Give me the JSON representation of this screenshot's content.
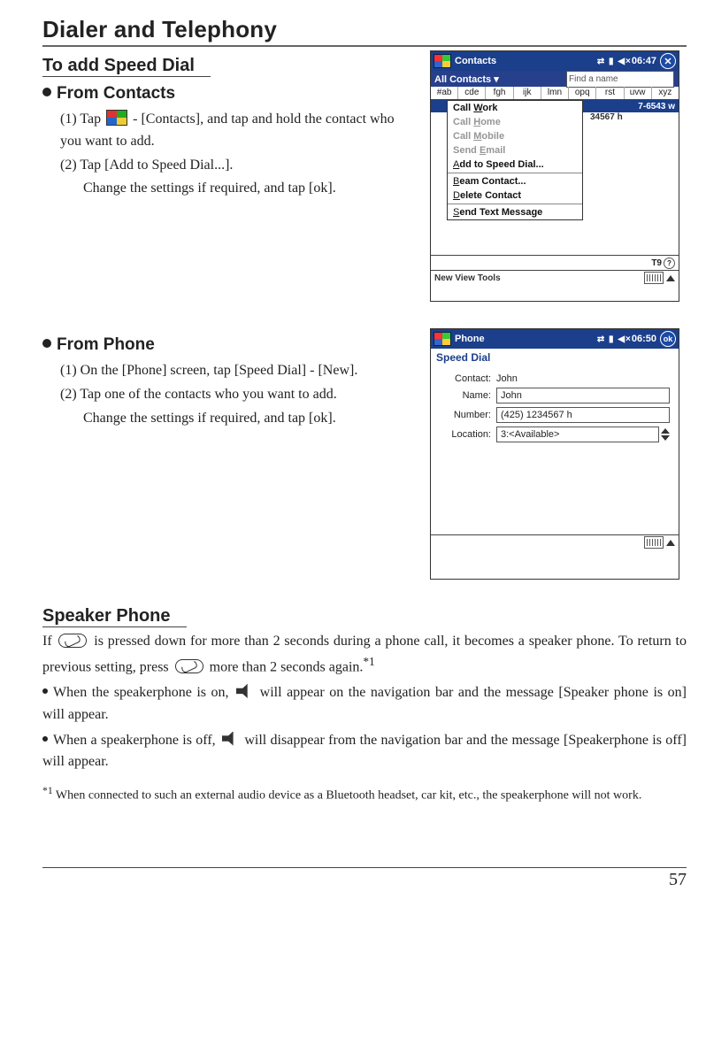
{
  "chapter_title": "Dialer and Telephony",
  "section1": {
    "title": "To add Speed Dial",
    "from_contacts": {
      "heading": "From Contacts",
      "step1": "(1) Tap ",
      "step1b": " - [Contacts], and tap and hold the contact who you want to add.",
      "step2": "(2) Tap [Add to Speed Dial...].",
      "step2b": "Change the settings if required, and tap [ok]."
    },
    "from_phone": {
      "heading": "From Phone",
      "step1": "(1) On the [Phone] screen,  tap [Speed Dial] - [New].",
      "step2": "(2) Tap one of the contacts who you want to add.",
      "step2b": "Change the settings if required, and tap [ok]."
    }
  },
  "shot_contacts": {
    "title": "Contacts",
    "time": "06:47",
    "find_label": "Find a name",
    "all": "All Contacts ▾",
    "alpha": [
      "#ab",
      "cde",
      "fgh",
      "ijk",
      "lmn",
      "opq",
      "rst",
      "uvw",
      "xyz"
    ],
    "bg_num1": "7-6543       w",
    "bg_num2": "34567         h",
    "menu": {
      "call_work": "Call Work",
      "call_home": "Call Home",
      "call_mobile": "Call Mobile",
      "send_email": "Send Email",
      "add_speed": "Add to Speed Dial...",
      "beam": "Beam Contact...",
      "delete": "Delete Contact",
      "send_text": "Send Text Message"
    },
    "footer_right": "T9",
    "footer": "New  View  Tools"
  },
  "shot_phone": {
    "title": "Phone",
    "time": "06:50",
    "ok": "ok",
    "subtitle": "Speed Dial",
    "contact_lbl": "Contact:",
    "contact_val": "John",
    "name_lbl": "Name:",
    "name_val": "John",
    "number_lbl": "Number:",
    "number_val": "(425) 1234567 h",
    "location_lbl": "Location:",
    "location_val": "3:<Available>"
  },
  "section2": {
    "title": "Speaker Phone",
    "p1a": "If ",
    "p1b": " is pressed down for more than 2 seconds during a phone call, it becomes a speaker phone.  To return to previous setting, press ",
    "p1c": " more than 2 seconds again.",
    "sup": "*1",
    "b1a": "When the speakerphone is on,  ",
    "b1b": " will appear on the navigation bar and the message [Speaker phone is on] will appear.",
    "b2a": "When a speakerphone is off, ",
    "b2b": " will disappear from the navigation bar and the message [Speakerphone is off] will appear.",
    "foot": " When connected to such an external audio device as a Bluetooth headset, car kit, etc., the speakerphone will not work."
  },
  "page_number": "57"
}
